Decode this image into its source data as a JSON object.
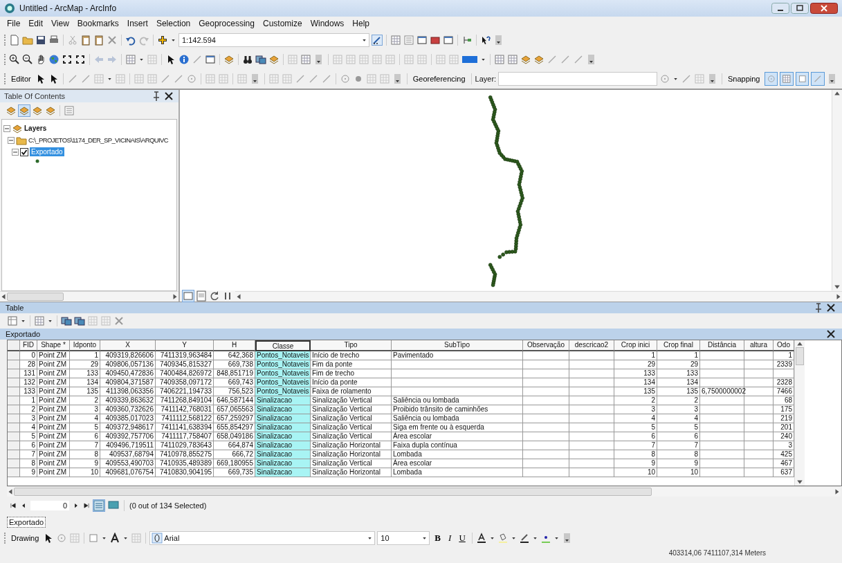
{
  "window": {
    "title": "Untitled - ArcMap - ArcInfo"
  },
  "menu": [
    "File",
    "Edit",
    "View",
    "Bookmarks",
    "Insert",
    "Selection",
    "Geoprocessing",
    "Customize",
    "Windows",
    "Help"
  ],
  "standard_toolbar": {
    "scale": "1:142.594"
  },
  "editor_toolbar": {
    "editor": "Editor",
    "georeferencing": "Georeferencing",
    "layer_label": "Layer:",
    "snapping": "Snapping",
    "snapping_buttons": [
      {
        "on": true
      },
      {
        "on": true
      },
      {
        "on": true
      },
      {
        "on": true
      }
    ]
  },
  "toc": {
    "title": "Table Of Contents",
    "layers": {
      "label": "Layers",
      "expanded": true,
      "children": [
        {
          "label": "C:\\_PROJETOS\\1174_DER_SP_VICINAIS\\ARQUIVC",
          "expanded": true,
          "children": [
            {
              "label": "Exportado",
              "checked": true,
              "selected": true,
              "expanded": true
            }
          ]
        }
      ]
    }
  },
  "table_panel": {
    "title": "Table",
    "table_name": "Exportado",
    "columns": [
      {
        "label": "FID",
        "kind": "number",
        "selected": false
      },
      {
        "label": "Shape *",
        "kind": "text",
        "selected": false
      },
      {
        "label": "Idponto",
        "kind": "number",
        "selected": false
      },
      {
        "label": "X",
        "kind": "number",
        "selected": false
      },
      {
        "label": "Y",
        "kind": "number",
        "selected": false
      },
      {
        "label": "H",
        "kind": "number",
        "selected": false
      },
      {
        "label": "Classe",
        "kind": "text",
        "selected": true
      },
      {
        "label": "Tipo",
        "kind": "text",
        "selected": false
      },
      {
        "label": "SubTipo",
        "kind": "text",
        "selected": false
      },
      {
        "label": "Observação",
        "kind": "text",
        "selected": false
      },
      {
        "label": "descricao2",
        "kind": "text",
        "selected": false
      },
      {
        "label": "Crop inici",
        "kind": "number",
        "selected": false
      },
      {
        "label": "Crop final",
        "kind": "number",
        "selected": false
      },
      {
        "label": "Distância",
        "kind": "text",
        "selected": false
      },
      {
        "label": "altura",
        "kind": "text",
        "selected": false
      },
      {
        "label": "Odo",
        "kind": "number",
        "selected": false
      }
    ],
    "rows": [
      [
        "0",
        "Point ZM",
        "1",
        "409319,826606",
        "7411319,963484",
        "642,368",
        "Pontos_Notaveis",
        "Início de trecho",
        "Pavimentado",
        null,
        null,
        "1",
        "1",
        null,
        null,
        "1"
      ],
      [
        "28",
        "Point ZM",
        "29",
        "409806,057136",
        "7409345,815327",
        "669,738",
        "Pontos_Notaveis",
        "Fim da ponte",
        null,
        null,
        null,
        "29",
        "29",
        null,
        null,
        "2339"
      ],
      [
        "131",
        "Point ZM",
        "133",
        "409450,472836",
        "7400484,826972",
        "848,851719",
        "Pontos_Notaveis",
        "Fim de trecho",
        null,
        null,
        null,
        "133",
        "133",
        null,
        null,
        null
      ],
      [
        "132",
        "Point ZM",
        "134",
        "409804,371587",
        "7409358,097172",
        "669,743",
        "Pontos_Notaveis",
        "Início da ponte",
        null,
        null,
        null,
        "134",
        "134",
        null,
        null,
        "2328"
      ],
      [
        "133",
        "Point ZM",
        "135",
        "411398,063356",
        "7406221,194733",
        "756,523",
        "Pontos_Notaveis",
        "Faixa de rolamento",
        null,
        null,
        null,
        "135",
        "135",
        "6,7500000002",
        null,
        "7466"
      ],
      [
        "1",
        "Point ZM",
        "2",
        "409339,863632",
        "7411268,849104",
        "646,587144",
        "Sinalizacao",
        "Sinalização Vertical",
        "Saliência ou lombada",
        null,
        null,
        "2",
        "2",
        null,
        null,
        "68"
      ],
      [
        "2",
        "Point ZM",
        "3",
        "409360,732626",
        "7411142,768031",
        "657,065563",
        "Sinalizacao",
        "Sinalização Vertical",
        "Proibido trânsito de caminhões",
        null,
        null,
        "3",
        "3",
        null,
        null,
        "175"
      ],
      [
        "3",
        "Point ZM",
        "4",
        "409385,017023",
        "7411112,568122",
        "657,259297",
        "Sinalizacao",
        "Sinalização Vertical",
        "Saliência ou lombada",
        null,
        null,
        "4",
        "4",
        null,
        null,
        "219"
      ],
      [
        "4",
        "Point ZM",
        "5",
        "409372,948617",
        "7411141,638394",
        "655,854297",
        "Sinalizacao",
        "Sinalização Vertical",
        "Siga em frente ou à esquerda",
        null,
        null,
        "5",
        "5",
        null,
        null,
        "201"
      ],
      [
        "5",
        "Point ZM",
        "6",
        "409392,757706",
        "7411117,758407",
        "658,049186",
        "Sinalizacao",
        "Sinalização Vertical",
        "Área escolar",
        null,
        null,
        "6",
        "6",
        null,
        null,
        "240"
      ],
      [
        "6",
        "Point ZM",
        "7",
        "409496,719511",
        "7411029,783643",
        "664,874",
        "Sinalizacao",
        "Sinalização Horizontal",
        "Faixa dupla contínua",
        null,
        null,
        "7",
        "7",
        null,
        null,
        "3"
      ],
      [
        "7",
        "Point ZM",
        "8",
        "409537,68794",
        "7410978,855275",
        "666,72",
        "Sinalizacao",
        "Sinalização Horizontal",
        "Lombada",
        null,
        null,
        "8",
        "8",
        null,
        null,
        "425"
      ],
      [
        "8",
        "Point ZM",
        "9",
        "409553,490703",
        "7410935,489389",
        "669,180955",
        "Sinalizacao",
        "Sinalização Vertical",
        "Área escolar",
        null,
        null,
        "9",
        "9",
        null,
        null,
        "467"
      ],
      [
        "9",
        "Point ZM",
        "10",
        "409681,076754",
        "7410830,904195",
        "669,735",
        "Sinalizacao",
        "Sinalização Horizontal",
        "Lombada",
        null,
        null,
        "10",
        "10",
        null,
        null,
        "637"
      ]
    ],
    "record": "0",
    "selection_text": "(0 out of 134 Selected)",
    "tab": "Exportado"
  },
  "drawing_toolbar": {
    "drawing": "Drawing",
    "font": "Arial",
    "size": "10",
    "bold": "B",
    "italic": "I",
    "underline": "U"
  },
  "status_bar": {
    "coordinates": "403314,06  7411107,314 Meters"
  }
}
